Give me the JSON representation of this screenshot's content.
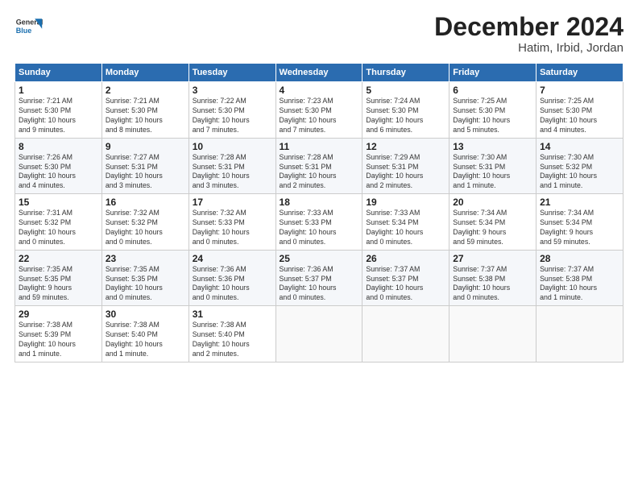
{
  "logo": {
    "general": "General",
    "blue": "Blue"
  },
  "title": "December 2024",
  "location": "Hatim, Irbid, Jordan",
  "days_of_week": [
    "Sunday",
    "Monday",
    "Tuesday",
    "Wednesday",
    "Thursday",
    "Friday",
    "Saturday"
  ],
  "weeks": [
    [
      {
        "day": "1",
        "info": "Sunrise: 7:21 AM\nSunset: 5:30 PM\nDaylight: 10 hours\nand 9 minutes."
      },
      {
        "day": "2",
        "info": "Sunrise: 7:21 AM\nSunset: 5:30 PM\nDaylight: 10 hours\nand 8 minutes."
      },
      {
        "day": "3",
        "info": "Sunrise: 7:22 AM\nSunset: 5:30 PM\nDaylight: 10 hours\nand 7 minutes."
      },
      {
        "day": "4",
        "info": "Sunrise: 7:23 AM\nSunset: 5:30 PM\nDaylight: 10 hours\nand 7 minutes."
      },
      {
        "day": "5",
        "info": "Sunrise: 7:24 AM\nSunset: 5:30 PM\nDaylight: 10 hours\nand 6 minutes."
      },
      {
        "day": "6",
        "info": "Sunrise: 7:25 AM\nSunset: 5:30 PM\nDaylight: 10 hours\nand 5 minutes."
      },
      {
        "day": "7",
        "info": "Sunrise: 7:25 AM\nSunset: 5:30 PM\nDaylight: 10 hours\nand 4 minutes."
      }
    ],
    [
      {
        "day": "8",
        "info": "Sunrise: 7:26 AM\nSunset: 5:30 PM\nDaylight: 10 hours\nand 4 minutes."
      },
      {
        "day": "9",
        "info": "Sunrise: 7:27 AM\nSunset: 5:31 PM\nDaylight: 10 hours\nand 3 minutes."
      },
      {
        "day": "10",
        "info": "Sunrise: 7:28 AM\nSunset: 5:31 PM\nDaylight: 10 hours\nand 3 minutes."
      },
      {
        "day": "11",
        "info": "Sunrise: 7:28 AM\nSunset: 5:31 PM\nDaylight: 10 hours\nand 2 minutes."
      },
      {
        "day": "12",
        "info": "Sunrise: 7:29 AM\nSunset: 5:31 PM\nDaylight: 10 hours\nand 2 minutes."
      },
      {
        "day": "13",
        "info": "Sunrise: 7:30 AM\nSunset: 5:31 PM\nDaylight: 10 hours\nand 1 minute."
      },
      {
        "day": "14",
        "info": "Sunrise: 7:30 AM\nSunset: 5:32 PM\nDaylight: 10 hours\nand 1 minute."
      }
    ],
    [
      {
        "day": "15",
        "info": "Sunrise: 7:31 AM\nSunset: 5:32 PM\nDaylight: 10 hours\nand 0 minutes."
      },
      {
        "day": "16",
        "info": "Sunrise: 7:32 AM\nSunset: 5:32 PM\nDaylight: 10 hours\nand 0 minutes."
      },
      {
        "day": "17",
        "info": "Sunrise: 7:32 AM\nSunset: 5:33 PM\nDaylight: 10 hours\nand 0 minutes."
      },
      {
        "day": "18",
        "info": "Sunrise: 7:33 AM\nSunset: 5:33 PM\nDaylight: 10 hours\nand 0 minutes."
      },
      {
        "day": "19",
        "info": "Sunrise: 7:33 AM\nSunset: 5:34 PM\nDaylight: 10 hours\nand 0 minutes."
      },
      {
        "day": "20",
        "info": "Sunrise: 7:34 AM\nSunset: 5:34 PM\nDaylight: 9 hours\nand 59 minutes."
      },
      {
        "day": "21",
        "info": "Sunrise: 7:34 AM\nSunset: 5:34 PM\nDaylight: 9 hours\nand 59 minutes."
      }
    ],
    [
      {
        "day": "22",
        "info": "Sunrise: 7:35 AM\nSunset: 5:35 PM\nDaylight: 9 hours\nand 59 minutes."
      },
      {
        "day": "23",
        "info": "Sunrise: 7:35 AM\nSunset: 5:35 PM\nDaylight: 10 hours\nand 0 minutes."
      },
      {
        "day": "24",
        "info": "Sunrise: 7:36 AM\nSunset: 5:36 PM\nDaylight: 10 hours\nand 0 minutes."
      },
      {
        "day": "25",
        "info": "Sunrise: 7:36 AM\nSunset: 5:37 PM\nDaylight: 10 hours\nand 0 minutes."
      },
      {
        "day": "26",
        "info": "Sunrise: 7:37 AM\nSunset: 5:37 PM\nDaylight: 10 hours\nand 0 minutes."
      },
      {
        "day": "27",
        "info": "Sunrise: 7:37 AM\nSunset: 5:38 PM\nDaylight: 10 hours\nand 0 minutes."
      },
      {
        "day": "28",
        "info": "Sunrise: 7:37 AM\nSunset: 5:38 PM\nDaylight: 10 hours\nand 1 minute."
      }
    ],
    [
      {
        "day": "29",
        "info": "Sunrise: 7:38 AM\nSunset: 5:39 PM\nDaylight: 10 hours\nand 1 minute."
      },
      {
        "day": "30",
        "info": "Sunrise: 7:38 AM\nSunset: 5:40 PM\nDaylight: 10 hours\nand 1 minute."
      },
      {
        "day": "31",
        "info": "Sunrise: 7:38 AM\nSunset: 5:40 PM\nDaylight: 10 hours\nand 2 minutes."
      },
      {
        "day": "",
        "info": ""
      },
      {
        "day": "",
        "info": ""
      },
      {
        "day": "",
        "info": ""
      },
      {
        "day": "",
        "info": ""
      }
    ]
  ]
}
